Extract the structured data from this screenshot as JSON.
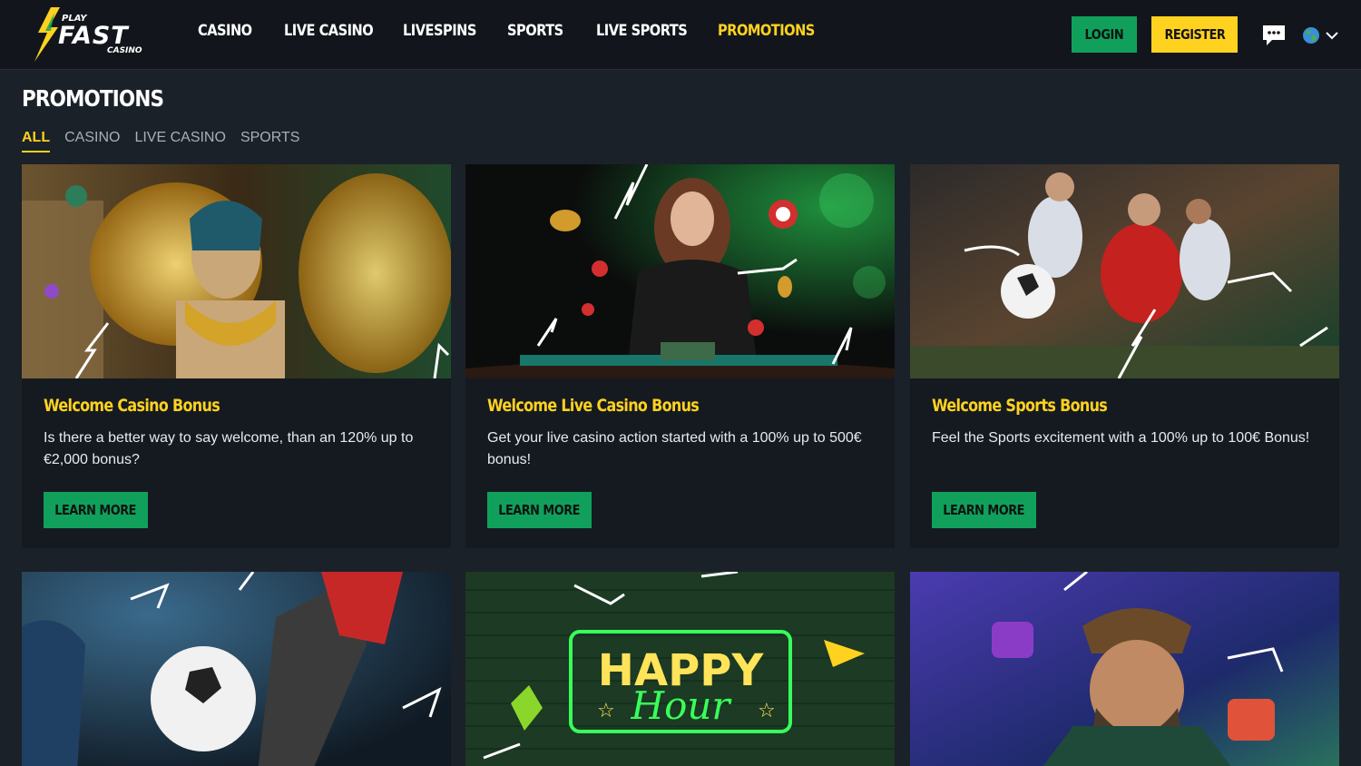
{
  "header": {
    "logo_top": "PLAY",
    "logo_main": "FAST",
    "logo_sub": "CASINO",
    "nav": [
      {
        "label": "CASINO",
        "active": false
      },
      {
        "label": "LIVE CASINO",
        "active": false
      },
      {
        "label": "LIVESPINS",
        "active": false
      },
      {
        "label": "SPORTS",
        "active": false
      },
      {
        "label": "LIVE SPORTS",
        "active": false
      },
      {
        "label": "PROMOTIONS",
        "active": true
      }
    ],
    "login_label": "LOGIN",
    "register_label": "REGISTER",
    "chat_icon": "chat-bubble-icon",
    "language_icon": "globe-icon"
  },
  "page": {
    "title": "PROMOTIONS",
    "filters": [
      {
        "label": "ALL",
        "active": true
      },
      {
        "label": "CASINO",
        "active": false
      },
      {
        "label": "LIVE CASINO",
        "active": false
      },
      {
        "label": "SPORTS",
        "active": false
      }
    ]
  },
  "promotions": [
    {
      "title": "Welcome Casino Bonus",
      "description": "Is there a better way to say welcome, than an 120% up to €2,000 bonus?",
      "button": "LEARN MORE"
    },
    {
      "title": "Welcome Live Casino Bonus",
      "description": "Get your live casino action started with a 100% up to 500€ bonus!",
      "button": "LEARN MORE"
    },
    {
      "title": "Welcome Sports Bonus",
      "description": "Feel the Sports excitement with a 100% up to 100€ Bonus!",
      "button": "LEARN MORE"
    }
  ],
  "second_row": {
    "happy_hour_line1": "HAPPY",
    "happy_hour_line2": "Hour"
  },
  "colors": {
    "accent_yellow": "#ffd21f",
    "accent_green": "#11a05c",
    "background": "#1b2129",
    "header": "#12161c",
    "card": "#151a20"
  }
}
